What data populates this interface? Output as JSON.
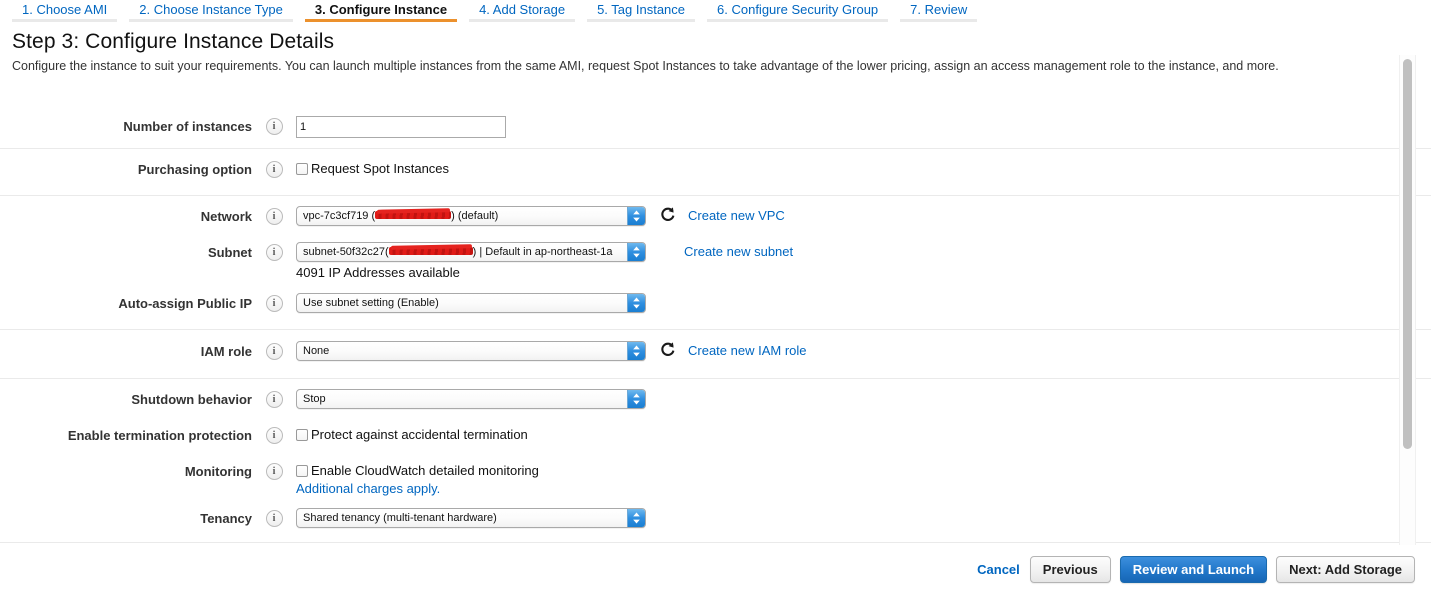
{
  "wizard": {
    "tabs": [
      {
        "label": "1. Choose AMI",
        "active": false
      },
      {
        "label": "2. Choose Instance Type",
        "active": false
      },
      {
        "label": "3. Configure Instance",
        "active": true
      },
      {
        "label": "4. Add Storage",
        "active": false
      },
      {
        "label": "5. Tag Instance",
        "active": false
      },
      {
        "label": "6. Configure Security Group",
        "active": false
      },
      {
        "label": "7. Review",
        "active": false
      }
    ],
    "active_accent_color": "#ec912d",
    "link_color": "#0066c0"
  },
  "page": {
    "title": "Step 3: Configure Instance Details",
    "description": "Configure the instance to suit your requirements. You can launch multiple instances from the same AMI, request Spot Instances to take advantage of the lower pricing, assign an access management role to the instance, and more."
  },
  "form": {
    "number_of_instances": {
      "label": "Number of instances",
      "info": "info-icon",
      "value": "1",
      "placeholder": ""
    },
    "purchasing_option": {
      "label": "Purchasing option",
      "info": "info-icon",
      "checkbox_label": "Request Spot Instances",
      "checked": false
    },
    "network": {
      "label": "Network",
      "info": "info-icon",
      "value_prefix": "vpc-7c3cf719 (",
      "value_redacted": true,
      "value_suffix": ") (default)",
      "refresh_icon": "refresh-icon",
      "link": "Create new VPC"
    },
    "subnet": {
      "label": "Subnet",
      "info": "info-icon",
      "value_prefix": "subnet-50f32c27(",
      "value_redacted": true,
      "value_suffix": ") | Default in ap-northeast-1a",
      "helper_text": "4091 IP Addresses available",
      "link": "Create new subnet"
    },
    "auto_assign_public_ip": {
      "label": "Auto-assign Public IP",
      "info": "info-icon",
      "value": "Use subnet setting (Enable)"
    },
    "iam_role": {
      "label": "IAM role",
      "info": "info-icon",
      "value": "None",
      "refresh_icon": "refresh-icon",
      "link": "Create new IAM role"
    },
    "shutdown_behavior": {
      "label": "Shutdown behavior",
      "info": "info-icon",
      "value": "Stop"
    },
    "termination_protection": {
      "label": "Enable termination protection",
      "info": "info-icon",
      "checkbox_label": "Protect against accidental termination",
      "checked": false
    },
    "monitoring": {
      "label": "Monitoring",
      "info": "info-icon",
      "checkbox_label": "Enable CloudWatch detailed monitoring",
      "checked": false,
      "link": "Additional charges apply."
    },
    "tenancy": {
      "label": "Tenancy",
      "info": "info-icon",
      "value": "Shared tenancy (multi-tenant hardware)"
    }
  },
  "footer": {
    "cancel": "Cancel",
    "previous": "Previous",
    "review_and_launch": "Review and Launch",
    "next": "Next: Add Storage",
    "primary_color": "#2277c9"
  }
}
